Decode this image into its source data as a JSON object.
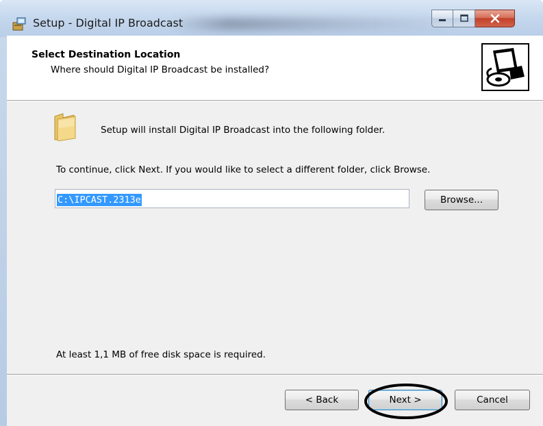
{
  "window": {
    "title": "Setup - Digital IP Broadcast",
    "icon": "setup-installer-icon",
    "caption_buttons": [
      "minimize",
      "maximize",
      "close"
    ]
  },
  "header": {
    "title": "Select Destination Location",
    "subtitle": "Where should Digital IP Broadcast be installed?",
    "image_icon": "computer-cd-install-icon"
  },
  "body": {
    "folder_icon": "folder-icon",
    "install_text": "Setup will install Digital IP Broadcast into the following folder.",
    "continue_text": "To continue, click Next. If you would like to select a different folder, click Browse.",
    "path_value": "C:\\IPCAST.2313e",
    "browse_label": "Browse...",
    "disk_space_text": "At least 1,1 MB of free disk space is required."
  },
  "footer": {
    "back_label": "< Back",
    "next_label": "Next >",
    "cancel_label": "Cancel"
  },
  "colors": {
    "selection": "#3399ff",
    "dialog_bg": "#f0f0f0",
    "close_button": "#c2412a",
    "annotation": "#000000"
  }
}
